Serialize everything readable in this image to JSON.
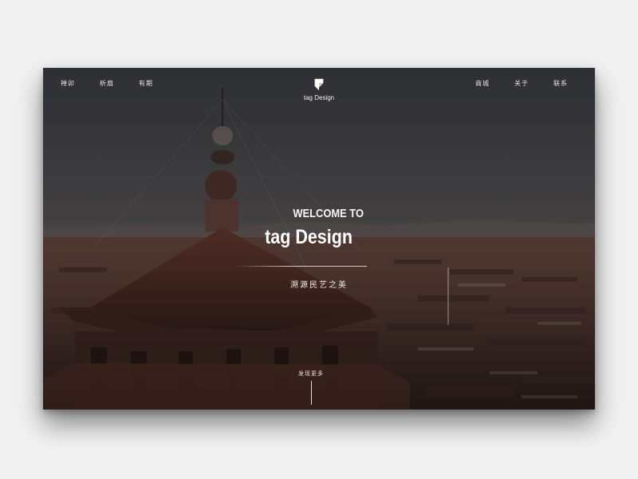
{
  "nav": {
    "left": [
      {
        "label": "禅卯"
      },
      {
        "label": "析扇"
      },
      {
        "label": "有期"
      }
    ],
    "right": [
      {
        "label": "商城"
      },
      {
        "label": "关于"
      },
      {
        "label": "联系"
      }
    ]
  },
  "logo": {
    "icon": "tag-logo-icon",
    "text": "tag Design"
  },
  "hero": {
    "welcome": "WELCOME TO",
    "brand": "tag Design",
    "tagline": "溯源民艺之美",
    "discover": "发现更多",
    "background": "pagoda-aerial-dusk"
  },
  "colors": {
    "text": "#ffffff",
    "page_bg": "#f1f1f1"
  }
}
